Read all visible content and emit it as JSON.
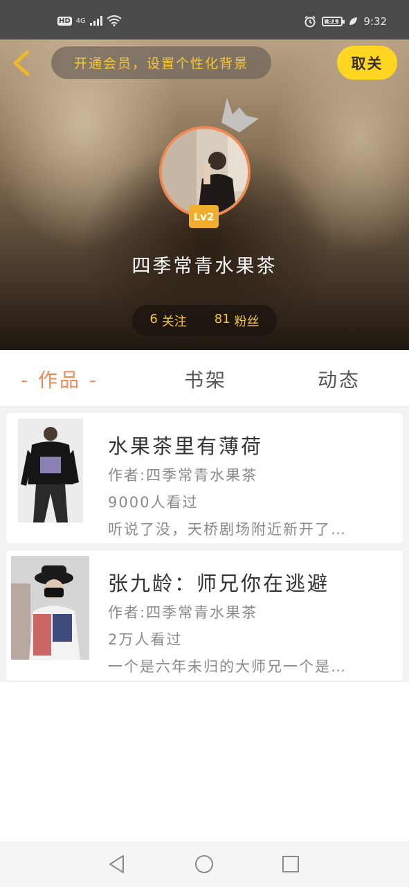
{
  "status_bar": {
    "network_label": "HD",
    "signal_type": "4G",
    "time": "9:32",
    "battery_level": "81",
    "icons": [
      "hd-icon",
      "signal-icon",
      "wifi-icon",
      "alarm-icon",
      "battery-icon",
      "leaf-icon"
    ]
  },
  "header": {
    "back_icon": "chevron-left-icon",
    "vip_banner": "开通会员，设置个性化背景",
    "unfollow_label": "取关",
    "level": "Lv2",
    "username": "四季常青水果茶",
    "following_count": "6",
    "following_label": "关注",
    "followers_count": "81",
    "followers_label": "粉丝"
  },
  "tabs": [
    {
      "label": "- 作品 -",
      "active": true
    },
    {
      "label": "书架",
      "active": false
    },
    {
      "label": "动态",
      "active": false
    }
  ],
  "books": [
    {
      "title": "水果茶里有薄荷",
      "author": "作者:四季常青水果茶",
      "views": "9000人看过",
      "desc": "听说了没，天桥剧场附近新开了…"
    },
    {
      "title": "张九龄：师兄你在逃避",
      "author": "作者:四季常青水果茶",
      "views": "2万人看过",
      "desc": "一个是六年未归的大师兄一个是…"
    }
  ],
  "nav_bar": {
    "icons": [
      "nav-back-icon",
      "nav-home-icon",
      "nav-recent-icon"
    ]
  },
  "colors": {
    "accent": "#f08a55",
    "vip_text": "#f5c73a",
    "unfollow_bg": "#fed520",
    "status_bar_bg": "#4a4a4a"
  }
}
